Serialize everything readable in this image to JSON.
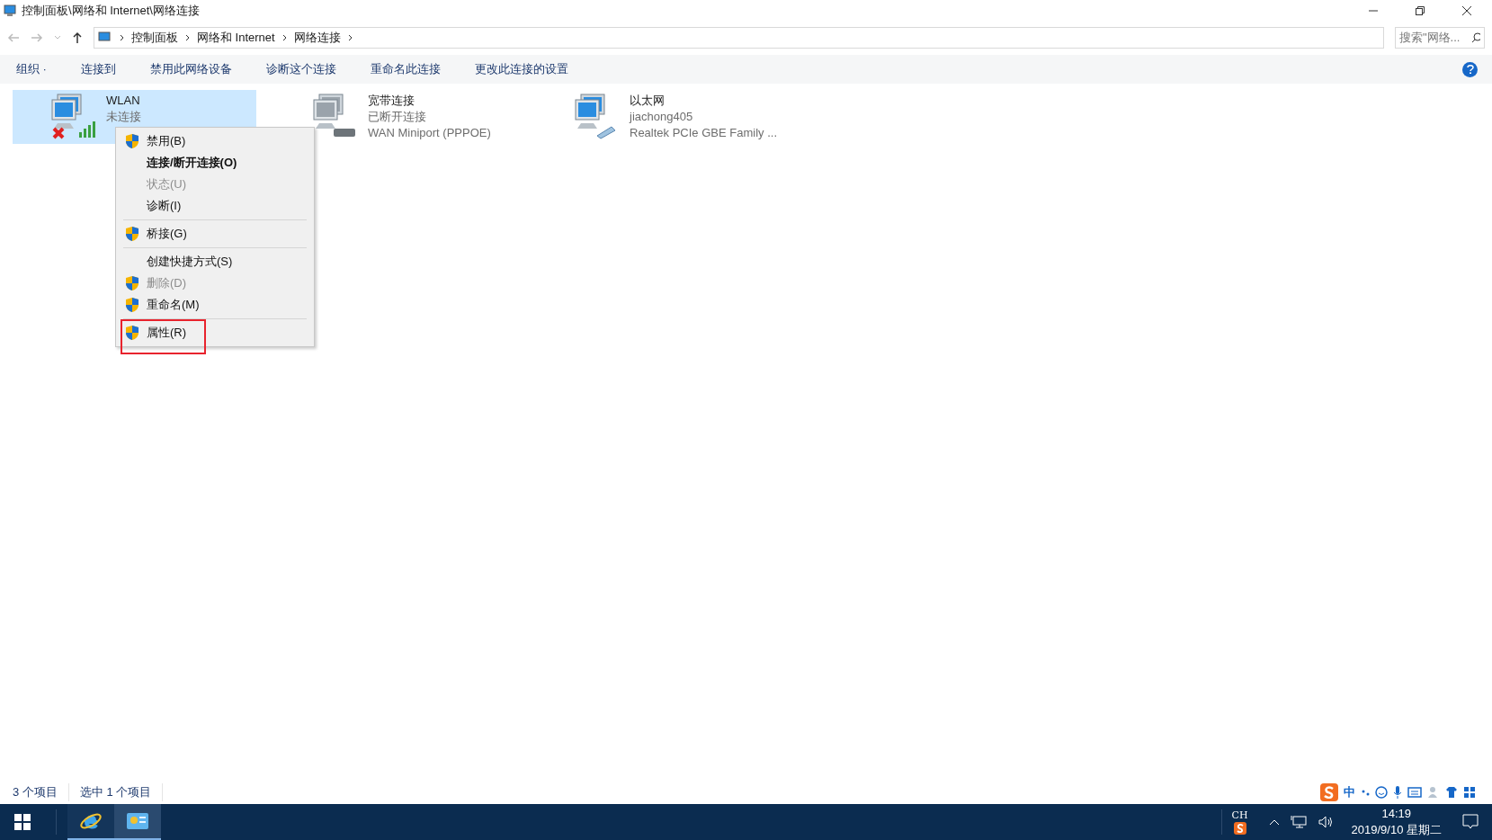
{
  "window": {
    "title": "控制面板\\网络和 Internet\\网络连接"
  },
  "address": {
    "path": [
      "控制面板",
      "网络和 Internet",
      "网络连接"
    ],
    "search_placeholder": "搜索\"网络..."
  },
  "toolbar": [
    {
      "label": "组织 ·"
    },
    {
      "label": "连接到"
    },
    {
      "label": "禁用此网络设备"
    },
    {
      "label": "诊断这个连接"
    },
    {
      "label": "重命名此连接"
    },
    {
      "label": "更改此连接的设置"
    }
  ],
  "connections": [
    {
      "kind": "wireless",
      "name": "WLAN",
      "status": "未连接",
      "selected": true
    },
    {
      "kind": "broadband",
      "name": "宽带连接",
      "status": "已断开连接",
      "device": "WAN Miniport (PPPOE)",
      "selected": false
    },
    {
      "kind": "ethernet",
      "name": "以太网",
      "status": "jiachong405",
      "device": "Realtek PCIe GBE Family ...",
      "selected": false
    }
  ],
  "context_menu": [
    {
      "kind": "item",
      "label": "禁用(B)",
      "shield": true,
      "disabled": false,
      "bold": false,
      "boxed": false
    },
    {
      "kind": "item",
      "label": "连接/断开连接(O)",
      "shield": false,
      "disabled": false,
      "bold": true,
      "boxed": false
    },
    {
      "kind": "item",
      "label": "状态(U)",
      "shield": false,
      "disabled": true,
      "bold": false,
      "boxed": false
    },
    {
      "kind": "item",
      "label": "诊断(I)",
      "shield": false,
      "disabled": false,
      "bold": false,
      "boxed": false
    },
    {
      "kind": "separator"
    },
    {
      "kind": "item",
      "label": "桥接(G)",
      "shield": true,
      "disabled": false,
      "bold": false,
      "boxed": false
    },
    {
      "kind": "separator"
    },
    {
      "kind": "item",
      "label": "创建快捷方式(S)",
      "shield": false,
      "disabled": false,
      "bold": false,
      "boxed": false
    },
    {
      "kind": "item",
      "label": "删除(D)",
      "shield": true,
      "disabled": true,
      "bold": false,
      "boxed": false
    },
    {
      "kind": "item",
      "label": "重命名(M)",
      "shield": true,
      "disabled": false,
      "bold": false,
      "boxed": false
    },
    {
      "kind": "separator"
    },
    {
      "kind": "item",
      "label": "属性(R)",
      "shield": true,
      "disabled": false,
      "bold": false,
      "boxed": true
    }
  ],
  "status_bar": [
    "3 个项目",
    "选中 1 个项目"
  ],
  "ime_bar": {
    "mode": "中"
  },
  "taskbar": {
    "apps": [
      {
        "kind": "browser",
        "selected": false
      },
      {
        "kind": "control-panel",
        "selected": true
      }
    ],
    "language": "CH",
    "time": "14:19",
    "date": "2019/9/10 星期二"
  }
}
